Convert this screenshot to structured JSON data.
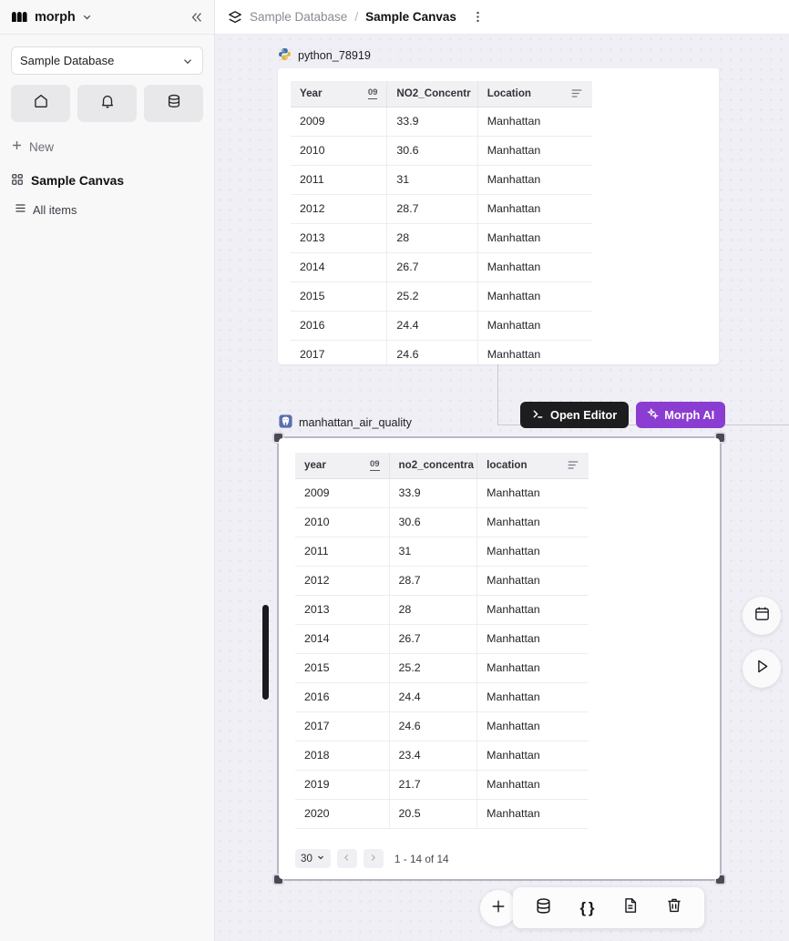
{
  "sidebar": {
    "brand": {
      "name": "morph",
      "logo_icon": "morph-logo-icon",
      "caret_icon": "chevron-down-icon"
    },
    "collapse_icon": "chevrons-left-icon",
    "database_select": {
      "value": "Sample Database",
      "caret_icon": "chevron-down-icon"
    },
    "icon_buttons": [
      {
        "name": "home",
        "icon": "home-icon"
      },
      {
        "name": "notifications",
        "icon": "bell-icon"
      },
      {
        "name": "database",
        "icon": "database-icon"
      }
    ],
    "new_label": "New",
    "new_icon": "plus-icon",
    "canvas_item": {
      "label": "Sample Canvas",
      "icon": "grid-icon"
    },
    "all_items": {
      "label": "All items",
      "icon": "list-icon"
    }
  },
  "topbar": {
    "breadcrumb_icon": "layers-icon",
    "parent": "Sample Database",
    "separator": "/",
    "current": "Sample Canvas",
    "more_icon": "more-vertical-icon"
  },
  "canvas": {
    "node1": {
      "label": "python_78919",
      "icon": "python-icon",
      "table": {
        "columns": [
          "Year",
          "NO2_Concentr",
          "Location"
        ],
        "type_badge": "09",
        "menu_icon": "table-menu-icon",
        "rows": [
          [
            "2009",
            "33.9",
            "Manhattan"
          ],
          [
            "2010",
            "30.6",
            "Manhattan"
          ],
          [
            "2011",
            "31",
            "Manhattan"
          ],
          [
            "2012",
            "28.7",
            "Manhattan"
          ],
          [
            "2013",
            "28",
            "Manhattan"
          ],
          [
            "2014",
            "26.7",
            "Manhattan"
          ],
          [
            "2015",
            "25.2",
            "Manhattan"
          ],
          [
            "2016",
            "24.4",
            "Manhattan"
          ],
          [
            "2017",
            "24.6",
            "Manhattan"
          ]
        ]
      }
    },
    "actions": {
      "open_editor": {
        "label": "Open Editor",
        "icon": "terminal-icon"
      },
      "morph_ai": {
        "label": "Morph AI",
        "icon": "sparkles-icon",
        "color": "#8b3dd1"
      }
    },
    "node2": {
      "label": "manhattan_air_quality",
      "icon": "postgres-icon",
      "selected": true,
      "table": {
        "columns": [
          "year",
          "no2_concentra",
          "location"
        ],
        "type_badge": "09",
        "menu_icon": "table-menu-icon",
        "rows": [
          [
            "2009",
            "33.9",
            "Manhattan"
          ],
          [
            "2010",
            "30.6",
            "Manhattan"
          ],
          [
            "2011",
            "31",
            "Manhattan"
          ],
          [
            "2012",
            "28.7",
            "Manhattan"
          ],
          [
            "2013",
            "28",
            "Manhattan"
          ],
          [
            "2014",
            "26.7",
            "Manhattan"
          ],
          [
            "2015",
            "25.2",
            "Manhattan"
          ],
          [
            "2016",
            "24.4",
            "Manhattan"
          ],
          [
            "2017",
            "24.6",
            "Manhattan"
          ],
          [
            "2018",
            "23.4",
            "Manhattan"
          ],
          [
            "2019",
            "21.7",
            "Manhattan"
          ],
          [
            "2020",
            "20.5",
            "Manhattan"
          ]
        ]
      },
      "pagination": {
        "page_size": "30",
        "page_size_caret": "chevron-down-icon",
        "prev_icon": "chevron-left-icon",
        "next_icon": "chevron-right-icon",
        "range_text": "1 - 14 of 14"
      }
    },
    "side_fabs": [
      {
        "name": "schedule",
        "icon": "calendar-icon"
      },
      {
        "name": "run",
        "icon": "play-icon"
      }
    ],
    "bottom_toolbar": {
      "add_icon": "plus-icon",
      "items": [
        {
          "name": "add-data-source",
          "icon": "database-icon"
        },
        {
          "name": "add-code-block",
          "icon": "braces-icon",
          "glyph": "{ }"
        },
        {
          "name": "add-document",
          "icon": "file-icon"
        },
        {
          "name": "delete",
          "icon": "trash-icon"
        }
      ]
    }
  }
}
